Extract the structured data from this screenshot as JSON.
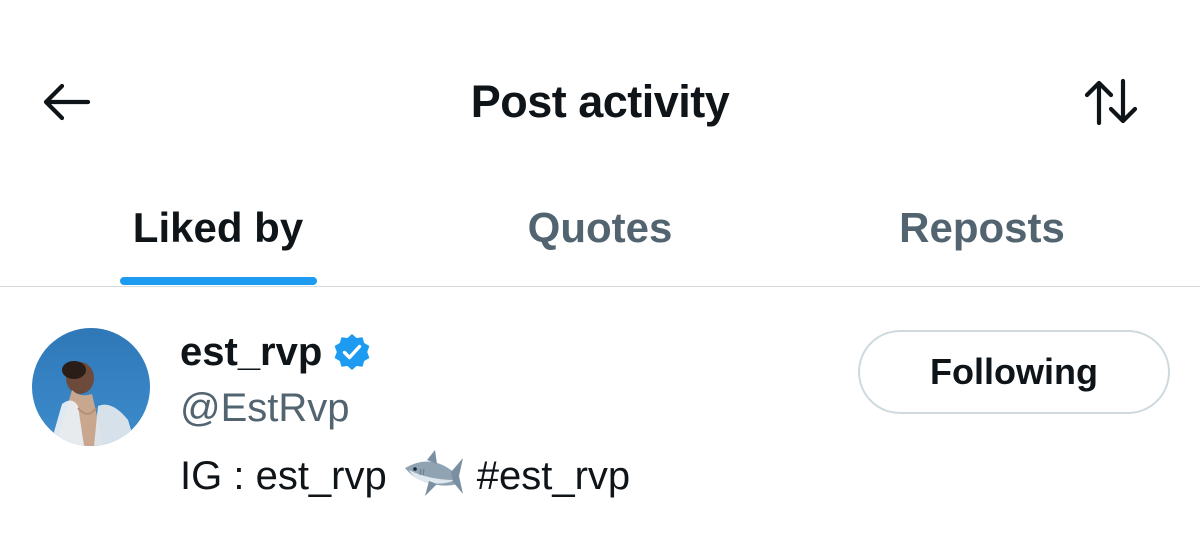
{
  "header": {
    "title": "Post activity",
    "back_icon": "back-arrow-icon",
    "sort_icon": "sort-arrows-icon"
  },
  "tabs": [
    {
      "label": "Liked by",
      "active": true
    },
    {
      "label": "Quotes",
      "active": false
    },
    {
      "label": "Reposts",
      "active": false
    }
  ],
  "colors": {
    "accent": "#1d9bf0",
    "text_primary": "#0f1419",
    "text_secondary": "#536471",
    "divider": "#d6d9dc"
  },
  "users": [
    {
      "display_name": "est_rvp",
      "verified": true,
      "handle": "@EstRvp",
      "bio_prefix": "IG : est_rvp",
      "bio_emoji": "shark-emoji",
      "bio_hashtag": "#est_rvp",
      "follow_label": "Following"
    }
  ]
}
